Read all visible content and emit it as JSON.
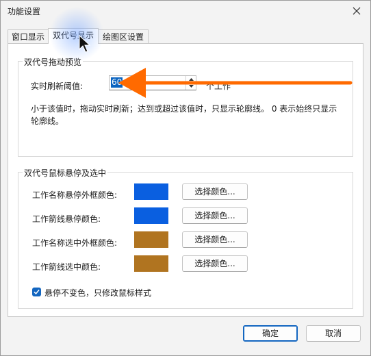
{
  "window": {
    "title": "功能设置",
    "close_icon": "close-icon"
  },
  "tabs": [
    {
      "label": "窗口显示",
      "active": false
    },
    {
      "label": "双代号显示",
      "active": true
    },
    {
      "label": "绘图区设置",
      "active": false
    }
  ],
  "drag_preview": {
    "group_title": "双代号拖动预览",
    "threshold_label": "实时刷新阈值:",
    "threshold_value": "60",
    "threshold_unit": "个工作",
    "description_line1": "小于该值时，拖动实时刷新；达到或超过该值时，只显示轮廓线。 0 表示始终只显示",
    "description_line2": "轮廓线。"
  },
  "hover_select": {
    "group_title": "双代号鼠标悬停及选中",
    "rows": [
      {
        "label": "工作名称悬停外框颜色:",
        "color": "#0a5fe0",
        "button": "选择颜色..."
      },
      {
        "label": "工作箭线悬停颜色:",
        "color": "#0a5fe0",
        "button": "选择颜色..."
      },
      {
        "label": "工作名称选中外框颜色:",
        "color": "#b07420",
        "button": "选择颜色..."
      },
      {
        "label": "工作箭线选中颜色:",
        "color": "#b07420",
        "button": "选择颜色..."
      }
    ],
    "checkbox_label": "悬停不变色，只修改鼠标样式",
    "checkbox_checked": true
  },
  "footer": {
    "ok": "确定",
    "cancel": "取消"
  },
  "annotation": {
    "arrow_color": "#ff6a00"
  }
}
